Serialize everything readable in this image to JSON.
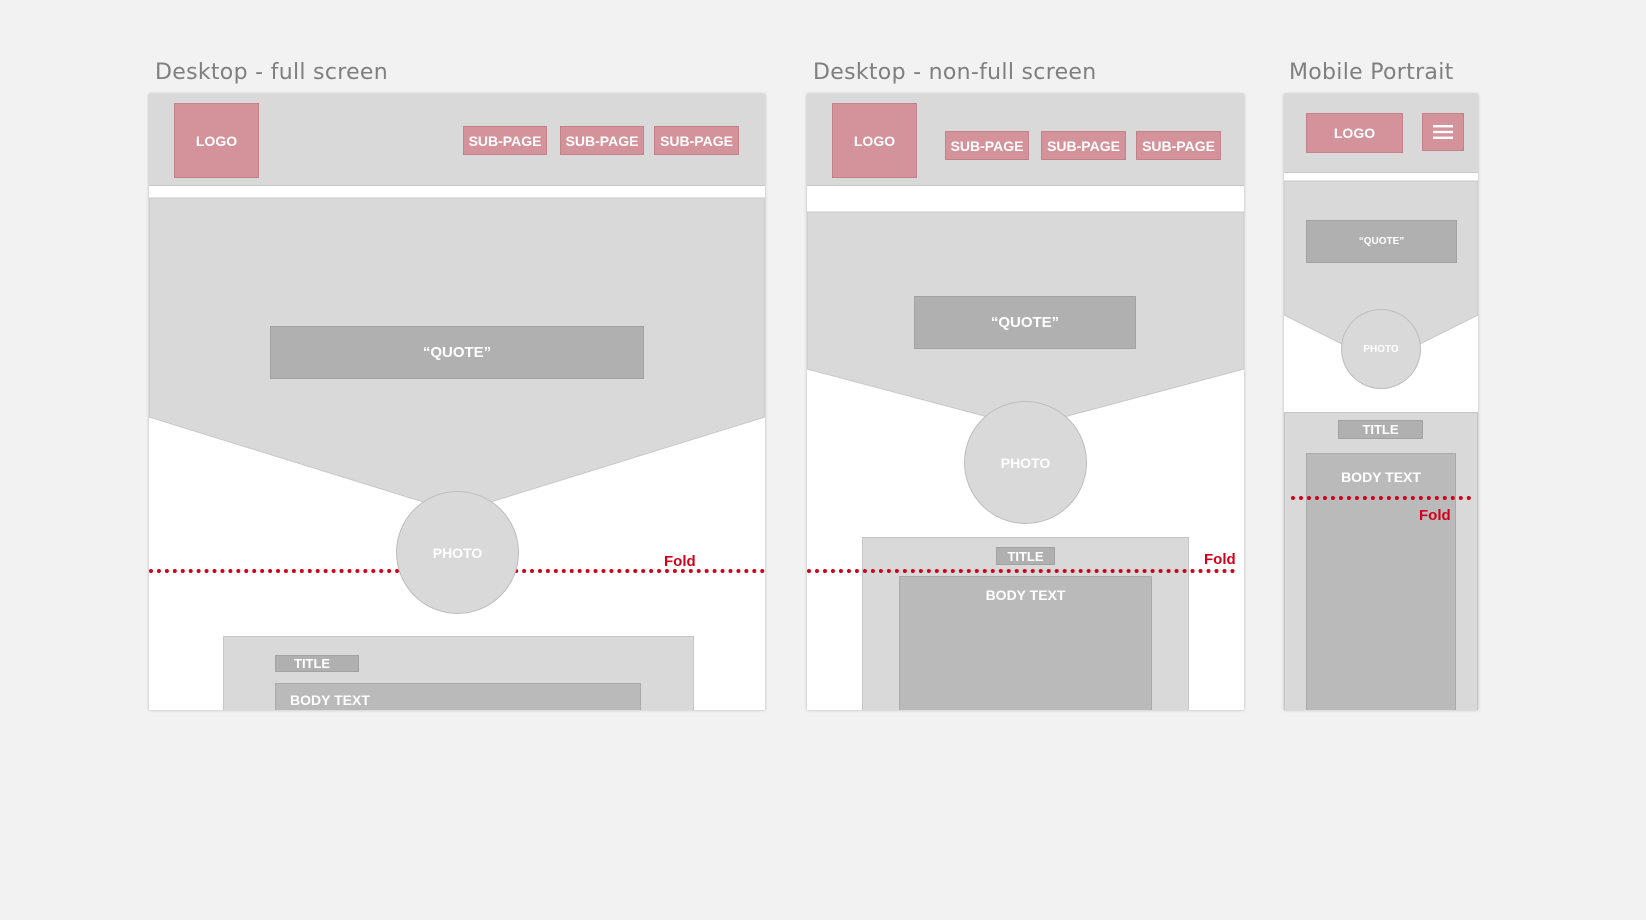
{
  "boards": {
    "desktop_full": {
      "title": "Desktop - full screen",
      "logo": "LOGO",
      "nav": [
        "SUB-PAGE",
        "SUB-PAGE",
        "SUB-PAGE"
      ],
      "quote": "“QUOTE”",
      "photo": "PHOTO",
      "fold": "Fold",
      "section_title": "TITLE",
      "body_text": "BODY TEXT"
    },
    "desktop_nonfull": {
      "title": "Desktop - non-full screen",
      "logo": "LOGO",
      "nav": [
        "SUB-PAGE",
        "SUB-PAGE",
        "SUB-PAGE"
      ],
      "quote": "“QUOTE”",
      "photo": "PHOTO",
      "fold": "Fold",
      "section_title": "TITLE",
      "body_text": "BODY TEXT"
    },
    "mobile_portrait": {
      "title": "Mobile Portrait",
      "logo": "LOGO",
      "menu_icon": "hamburger-menu-icon",
      "quote": "“QUOTE”",
      "photo": "PHOTO",
      "section_title": "TITLE",
      "body_text": "BODY TEXT",
      "fold": "Fold"
    }
  },
  "colors": {
    "background": "#f2f2f2",
    "header": "#d9d9d9",
    "accent_pink": "#d4939a",
    "quote_box": "#b0b0b0",
    "body_box": "#bbbabb",
    "fold_line": "#d0021b"
  }
}
